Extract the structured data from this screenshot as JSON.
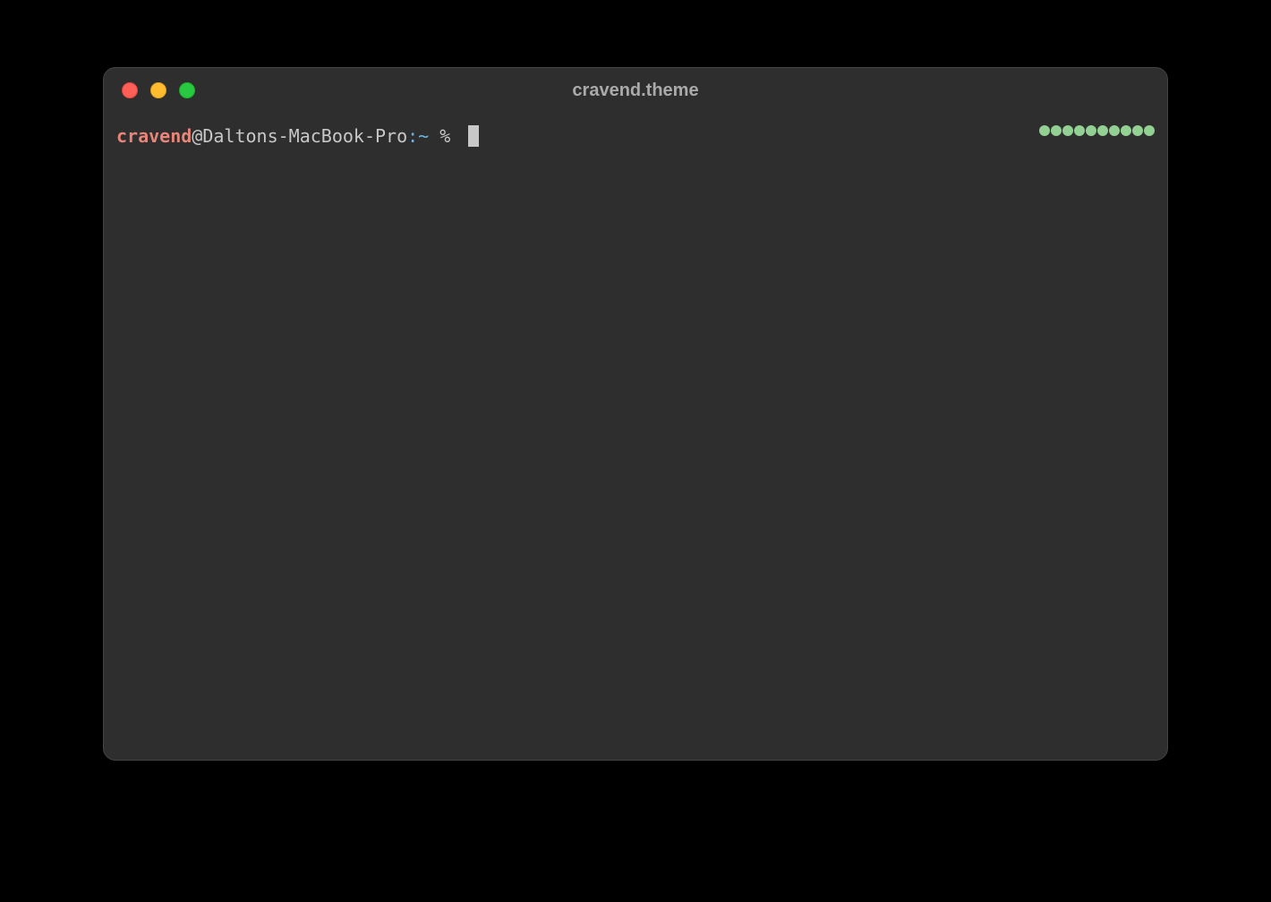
{
  "window": {
    "title": "cravend.theme"
  },
  "prompt": {
    "user": "cravend",
    "at": "@",
    "host": "Daltons-MacBook-Pro",
    "colon": ":",
    "path": "~",
    "symbol": " % "
  },
  "indicator": {
    "dot_count": 10,
    "color": "#93d093"
  },
  "traffic_lights": {
    "close": "close",
    "minimize": "minimize",
    "maximize": "maximize"
  }
}
